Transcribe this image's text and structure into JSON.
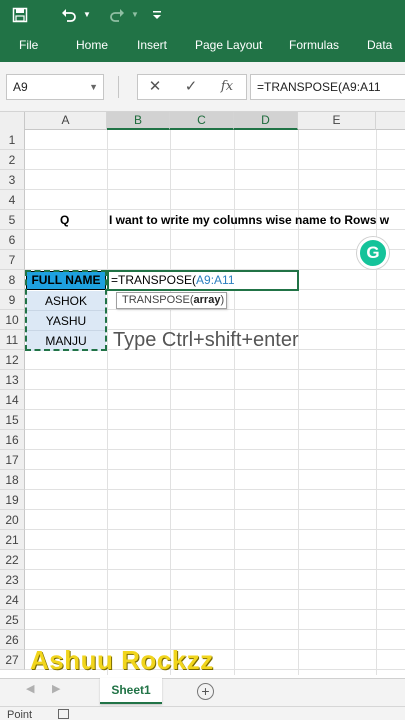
{
  "qat": {
    "save_icon": "save-icon",
    "undo_icon": "undo-icon",
    "redo_icon": "redo-icon"
  },
  "ribbon": {
    "tabs": [
      {
        "label": "File"
      },
      {
        "label": "Home"
      },
      {
        "label": "Insert"
      },
      {
        "label": "Page Layout"
      },
      {
        "label": "Formulas"
      },
      {
        "label": "Data"
      }
    ]
  },
  "formula_bar": {
    "name_box": "A9",
    "formula": "=TRANSPOSE(A9:A11"
  },
  "grid": {
    "columns": [
      "A",
      "B",
      "C",
      "D",
      "E"
    ],
    "rows": [
      "1",
      "2",
      "3",
      "4",
      "5",
      "6",
      "7",
      "8",
      "9",
      "10",
      "11",
      "12",
      "13",
      "14",
      "15",
      "16",
      "17",
      "18",
      "19",
      "20",
      "21",
      "22",
      "23",
      "24",
      "25",
      "26",
      "27"
    ],
    "cells": {
      "a5": "Q",
      "b5": "I want to write my columns wise name to Rows w",
      "a8": "FULL NAME",
      "a9": "ASHOK",
      "a10": "YASHU",
      "a11": "MANJU"
    },
    "edit_formula_prefix": "=TRANSPOSE(",
    "edit_formula_ref": "A9:A11",
    "tooltip_fn": "TRANSPOSE(",
    "tooltip_arg": "array",
    "tooltip_close": ")"
  },
  "overlay_note": "Type Ctrl+shift+enter",
  "grammarly_letter": "G",
  "watermark": "Ashuu Rockzz",
  "sheets": [
    {
      "label": "Sheet1"
    }
  ],
  "add_sheet_label": "+",
  "status": {
    "mode": "Point"
  },
  "colors": {
    "excel_green": "#217346",
    "header_fill": "#1ea1e0",
    "watermark": "#f1d51d",
    "grammarly": "#15c39a"
  }
}
